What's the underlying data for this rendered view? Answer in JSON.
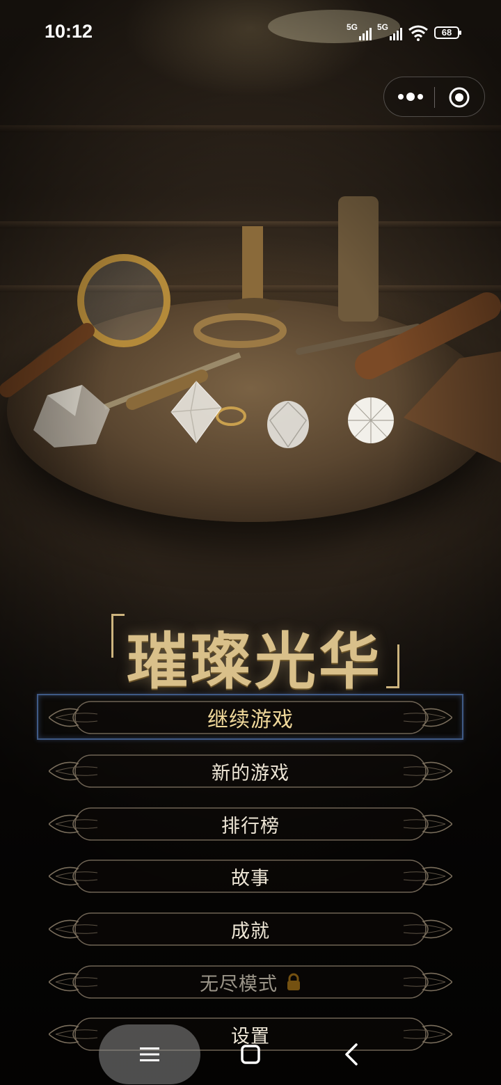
{
  "status_bar": {
    "time": "10:12",
    "sim1_label": "5G",
    "sim2_label": "5G",
    "battery_level": "68",
    "icons": [
      "signal-icon",
      "signal-icon",
      "wifi-icon",
      "battery-icon"
    ]
  },
  "capsule": {
    "more_icon": "more-dots-icon",
    "close_icon": "target-close-icon"
  },
  "game": {
    "title": "璀璨光华"
  },
  "menu": {
    "items": [
      {
        "label": "继续游戏",
        "selected": true,
        "locked": false
      },
      {
        "label": "新的游戏",
        "selected": false,
        "locked": false
      },
      {
        "label": "排行榜",
        "selected": false,
        "locked": false
      },
      {
        "label": "故事",
        "selected": false,
        "locked": false
      },
      {
        "label": "成就",
        "selected": false,
        "locked": false
      },
      {
        "label": "无尽模式",
        "selected": false,
        "locked": true
      },
      {
        "label": "设置",
        "selected": false,
        "locked": false
      }
    ]
  },
  "colors": {
    "title_gold": "#d9c08a",
    "selection_border": "#3f5a86",
    "lock_orange": "#f2a81e"
  },
  "nav_bar": {
    "icons": [
      "menu-icon",
      "home-icon",
      "back-icon"
    ]
  }
}
